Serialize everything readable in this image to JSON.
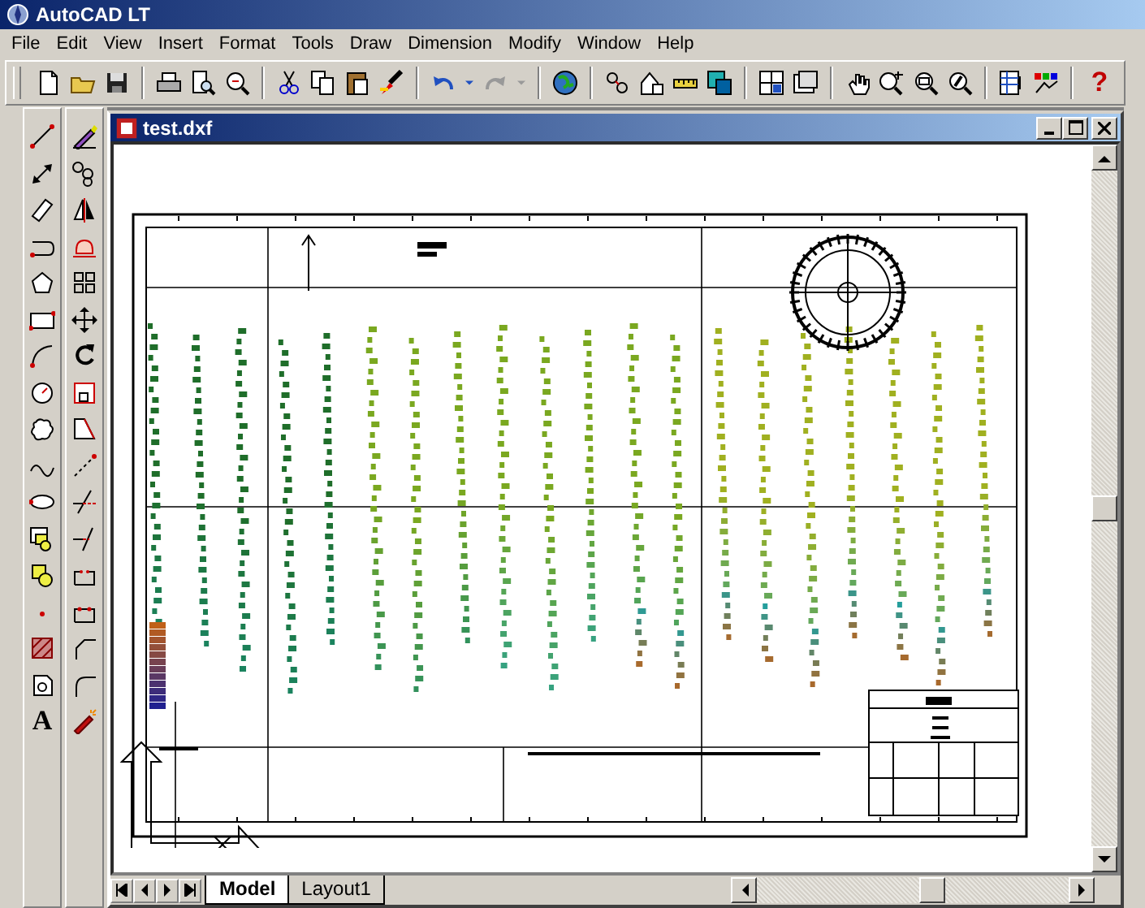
{
  "window": {
    "title": "AutoCAD LT"
  },
  "menu": [
    "File",
    "Edit",
    "View",
    "Insert",
    "Format",
    "Tools",
    "Draw",
    "Dimension",
    "Modify",
    "Window",
    "Help"
  ],
  "help_button": "?",
  "text_tool": "A",
  "document": {
    "title": "test.dxf"
  },
  "layout_tabs": [
    {
      "label": "Model",
      "selected": true
    },
    {
      "label": "Layout1",
      "selected": false
    }
  ]
}
